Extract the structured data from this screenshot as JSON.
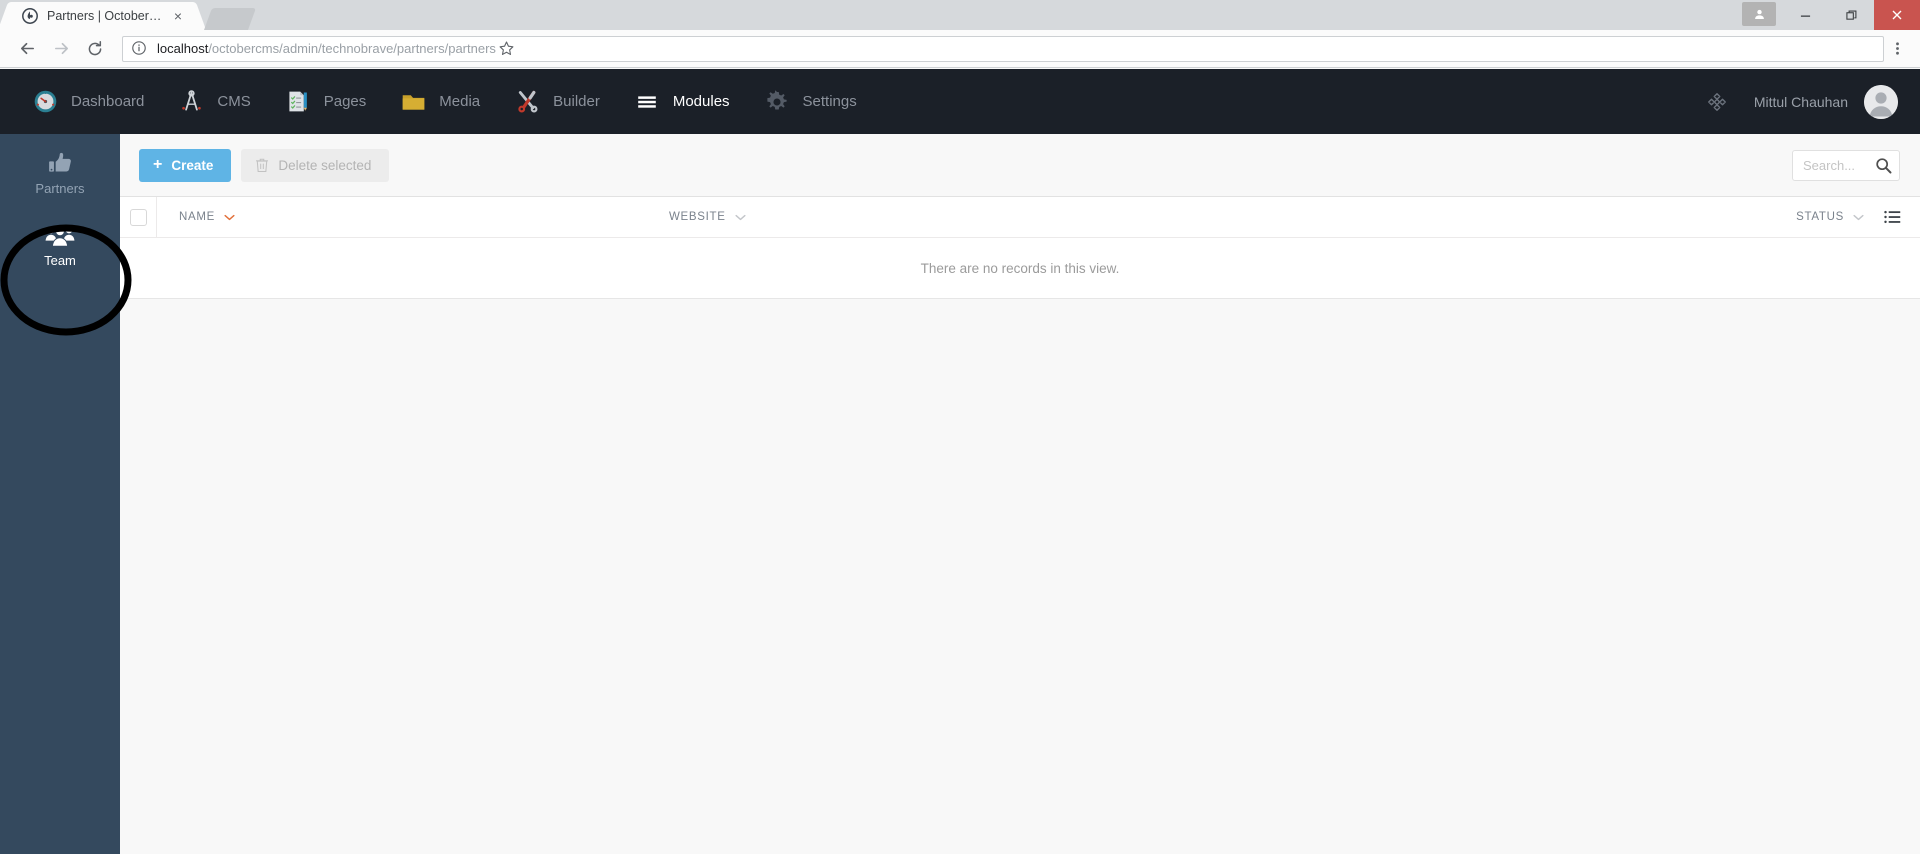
{
  "browser": {
    "tab": {
      "title": "Partners | OctoberCMS",
      "favicon_name": "octobercms-favicon",
      "close_label": "×"
    },
    "newtab_label": "",
    "back_label": "←",
    "forward_label": "→",
    "reload_label": "↻",
    "address": {
      "host": "localhost",
      "path": "/octobercms/admin/technobrave/partners/partners",
      "full": "localhost/octobercms/admin/technobrave/partners/partners"
    },
    "window_controls": {
      "minimize": "–",
      "maximize": "❐",
      "close": "✕"
    }
  },
  "topnav": {
    "items": [
      {
        "label": "Dashboard",
        "icon": "speedometer-icon",
        "active": false
      },
      {
        "label": "CMS",
        "icon": "compass-divider-icon",
        "active": false
      },
      {
        "label": "Pages",
        "icon": "document-pencil-icon",
        "active": false
      },
      {
        "label": "Media",
        "icon": "folder-icon",
        "active": false
      },
      {
        "label": "Builder",
        "icon": "tools-icon",
        "active": false
      },
      {
        "label": "Modules",
        "icon": "hamburger-icon",
        "active": true
      },
      {
        "label": "Settings",
        "icon": "gear-icon",
        "active": false
      }
    ],
    "tool_icon": "crosshair-icon",
    "username": "Mittul Chauhan",
    "avatar_name": "user-avatar"
  },
  "sidebar": {
    "items": [
      {
        "label": "Partners",
        "icon": "thumbs-up-icon",
        "active": false
      },
      {
        "label": "Team",
        "icon": "group-people-icon",
        "active": true
      }
    ]
  },
  "toolbar": {
    "create_label": "Create",
    "create_plus": "+",
    "delete_label": "Delete selected",
    "delete_disabled": true
  },
  "search": {
    "value": "",
    "placeholder": "Search..."
  },
  "table": {
    "columns": [
      {
        "label": "NAME",
        "sort": "desc",
        "sort_active": true
      },
      {
        "label": "WEBSITE",
        "sort": "desc",
        "sort_active": false
      },
      {
        "label": "STATUS",
        "sort": "desc",
        "sort_active": false
      }
    ],
    "rows": [],
    "empty_message": "There are no records in this view.",
    "columns_button_name": "column-settings-icon"
  },
  "annotation": {
    "shape": "ellipse",
    "target": "Team",
    "color": "#000000"
  },
  "colors": {
    "accent_blue": "#5fb4e5",
    "sidebar_bg": "#34495e",
    "topnav_bg": "#1b2028",
    "page_bg": "#f8f8f8",
    "sort_active": "#e2703a"
  }
}
